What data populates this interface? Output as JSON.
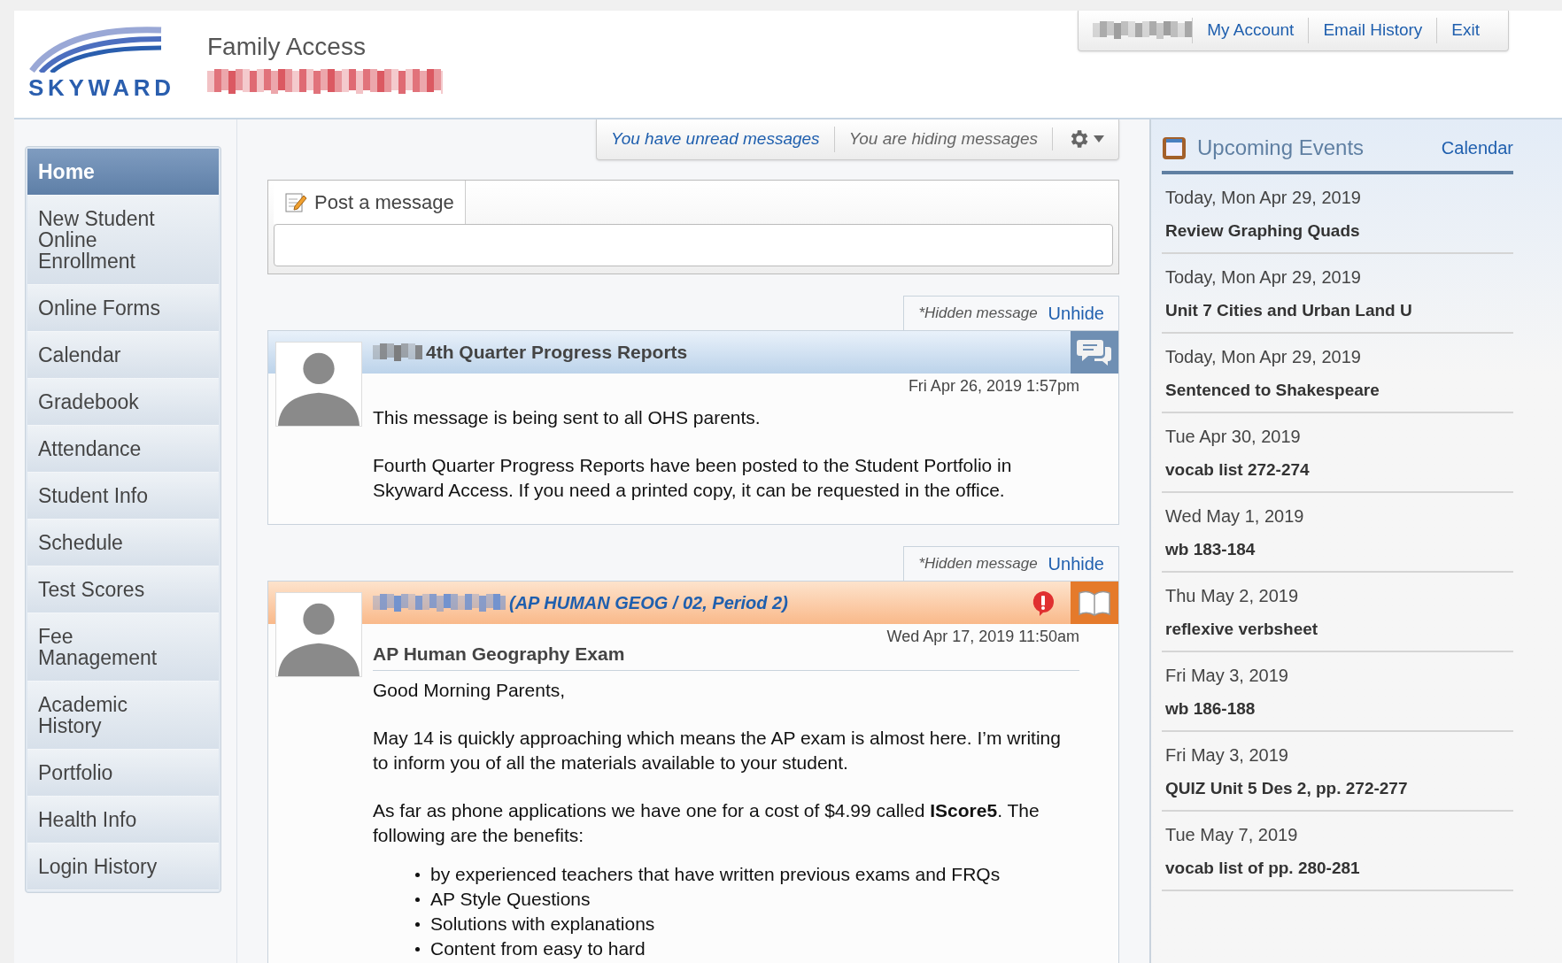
{
  "header": {
    "logo_text": "SKYWARD",
    "app_title": "Family Access",
    "links": [
      "My Account",
      "Email History",
      "Exit"
    ]
  },
  "sidebar": {
    "items": [
      {
        "label": "Home",
        "selected": true
      },
      {
        "label": "New Student Online Enrollment",
        "selected": false
      },
      {
        "label": "Online Forms",
        "selected": false
      },
      {
        "label": "Calendar",
        "selected": false
      },
      {
        "label": "Gradebook",
        "selected": false
      },
      {
        "label": "Attendance",
        "selected": false
      },
      {
        "label": "Student Info",
        "selected": false
      },
      {
        "label": "Schedule",
        "selected": false
      },
      {
        "label": "Test Scores",
        "selected": false
      },
      {
        "label": "Fee Management",
        "selected": false
      },
      {
        "label": "Academic History",
        "selected": false
      },
      {
        "label": "Portfolio",
        "selected": false
      },
      {
        "label": "Health Info",
        "selected": false
      },
      {
        "label": "Login History",
        "selected": false
      }
    ]
  },
  "message_bar": {
    "unread": "You have unread messages",
    "hiding": "You are hiding messages"
  },
  "post": {
    "tab": "Post a message"
  },
  "messages": [
    {
      "kind": "district",
      "hidden_note": "*Hidden message",
      "unhide": "Unhide",
      "title": "4th Quarter Progress Reports",
      "date": "Fri Apr 26, 2019 1:57pm",
      "important": false,
      "body": [
        "This message is being sent to all OHS parents.",
        "Fourth Quarter Progress Reports have been posted to the Student Portfolio in Skyward Access. If you need a printed copy, it can be requested in the office."
      ]
    },
    {
      "kind": "class",
      "hidden_note": "*Hidden message",
      "unhide": "Unhide",
      "title": "(AP HUMAN GEOG / 02, Period 2)",
      "subject": "AP Human Geography Exam",
      "date": "Wed Apr 17, 2019 11:50am",
      "important": true,
      "body": [
        "Good Morning Parents,",
        "May 14  is quickly approaching which means the AP exam is almost here. I’m writing to inform you of all the materials available to your student.",
        "As far as phone applications we have one for a cost of $4.99 called **IScore5**. The following are the benefits:"
      ],
      "bullets": [
        "by experienced teachers that have written previous exams and FRQs",
        "AP Style Questions",
        "Solutions with explanations",
        "Content from easy to hard"
      ]
    }
  ],
  "events": {
    "title": "Upcoming Events",
    "link": "Calendar",
    "items": [
      {
        "date": "Today, Mon Apr 29, 2019",
        "name": "Review Graphing Quads"
      },
      {
        "date": "Today, Mon Apr 29, 2019",
        "name": "Unit 7 Cities and Urban Land U"
      },
      {
        "date": "Today, Mon Apr 29, 2019",
        "name": "Sentenced to Shakespeare"
      },
      {
        "date": "Tue Apr 30, 2019",
        "name": "vocab list 272-274"
      },
      {
        "date": "Wed May 1, 2019",
        "name": "wb 183-184"
      },
      {
        "date": "Thu May 2, 2019",
        "name": "reflexive verbsheet"
      },
      {
        "date": "Fri May 3, 2019",
        "name": "wb 186-188"
      },
      {
        "date": "Fri May 3, 2019",
        "name": "QUIZ Unit 5 Des 2, pp. 272-277"
      },
      {
        "date": "Tue May 7, 2019",
        "name": "vocab list of pp. 280-281"
      }
    ]
  }
}
